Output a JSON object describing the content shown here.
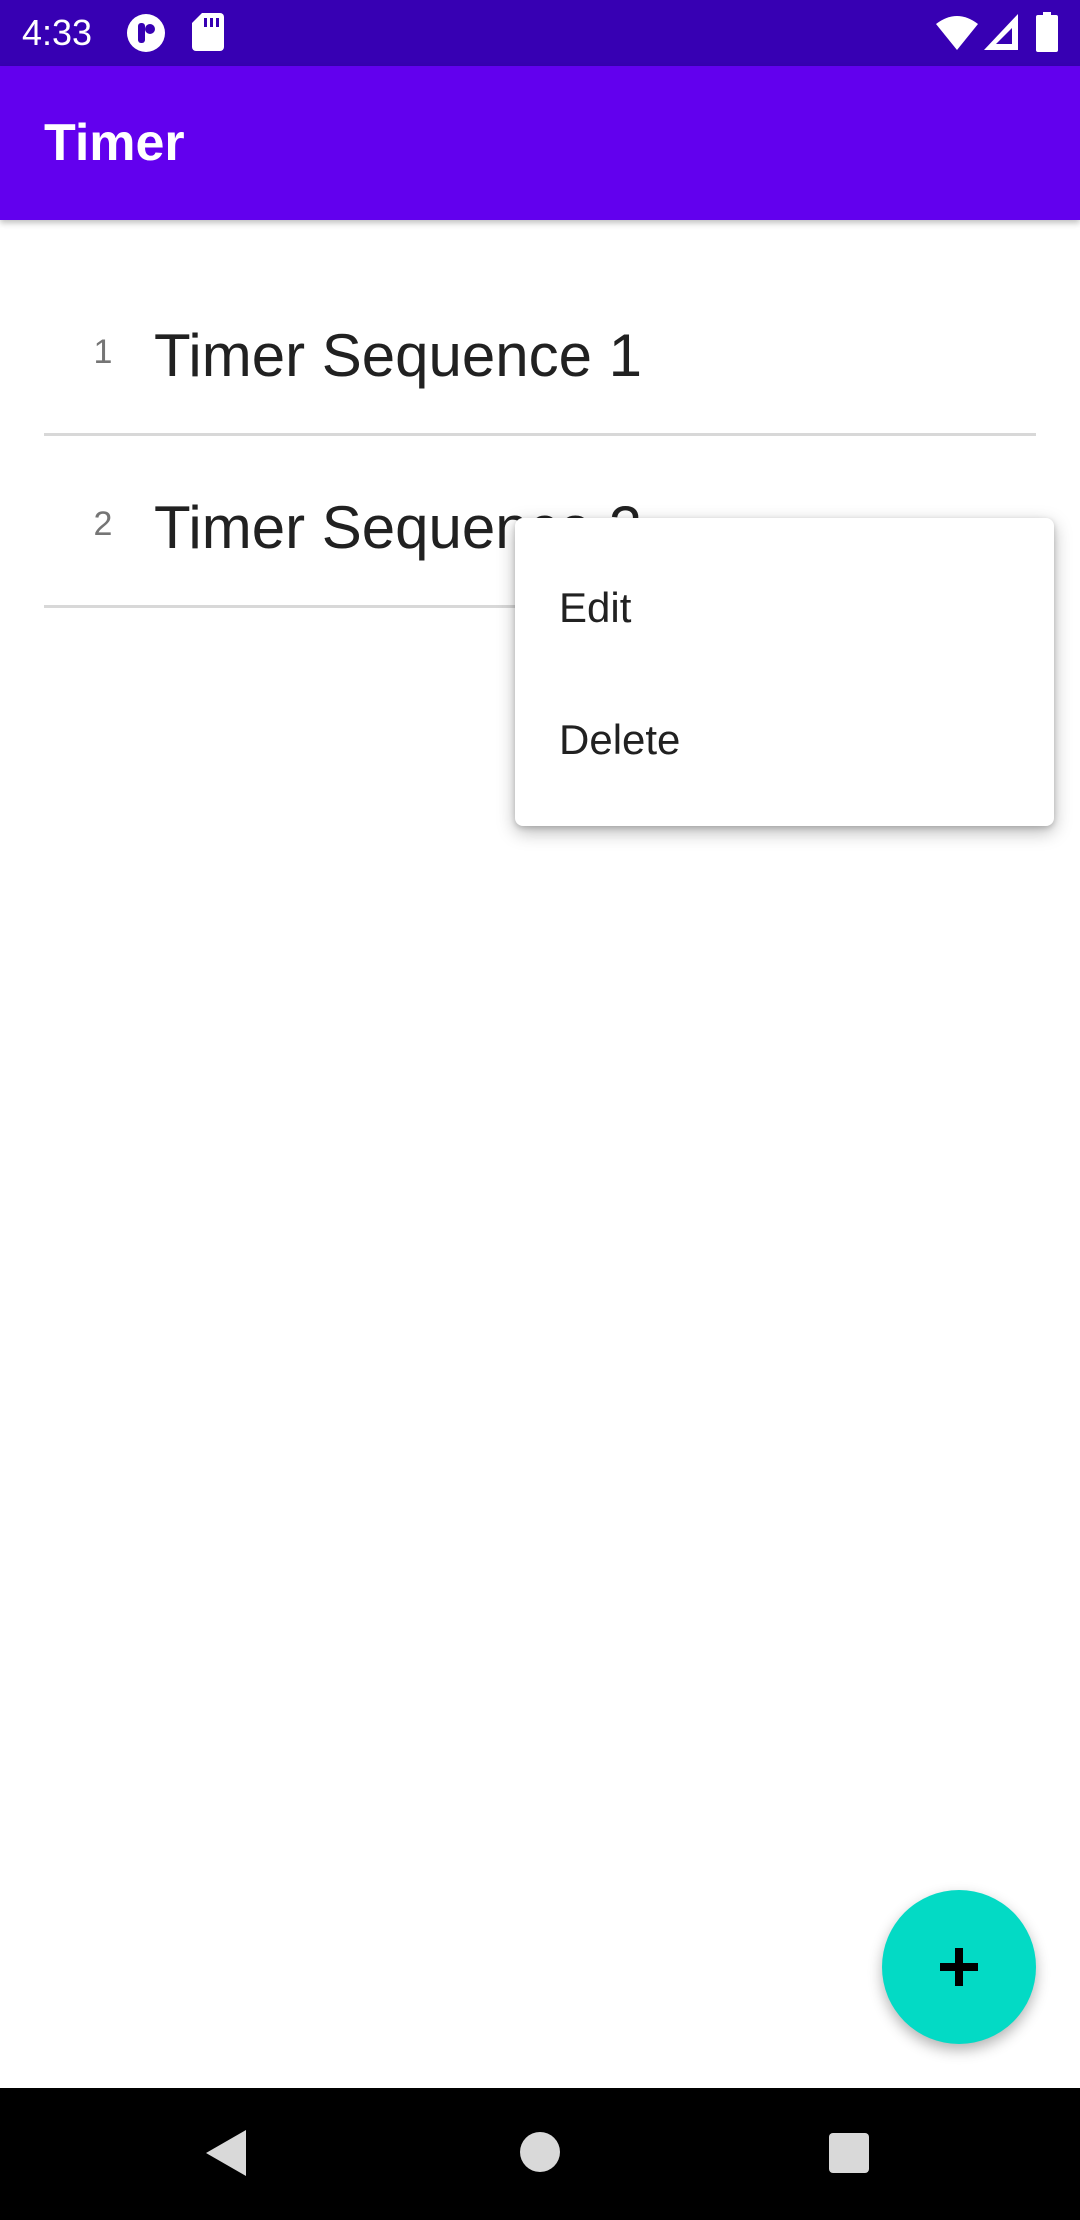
{
  "status_bar": {
    "time": "4:33",
    "left_icons": [
      "pocket-casts-icon",
      "sd-card-icon"
    ],
    "right_icons": [
      "wifi-icon",
      "cell-signal-icon",
      "battery-icon"
    ]
  },
  "app_bar": {
    "title": "Timer",
    "color": "#6200EE"
  },
  "sequences": [
    {
      "index": "1",
      "title": "Timer Sequence 1"
    },
    {
      "index": "2",
      "title": "Timer Sequence 2"
    }
  ],
  "context_menu": {
    "items": [
      "Edit",
      "Delete"
    ]
  },
  "fab": {
    "icon": "plus-icon",
    "color": "#03DAC5"
  },
  "nav_bar": {
    "buttons": [
      "back-icon",
      "home-icon",
      "recents-icon"
    ]
  }
}
